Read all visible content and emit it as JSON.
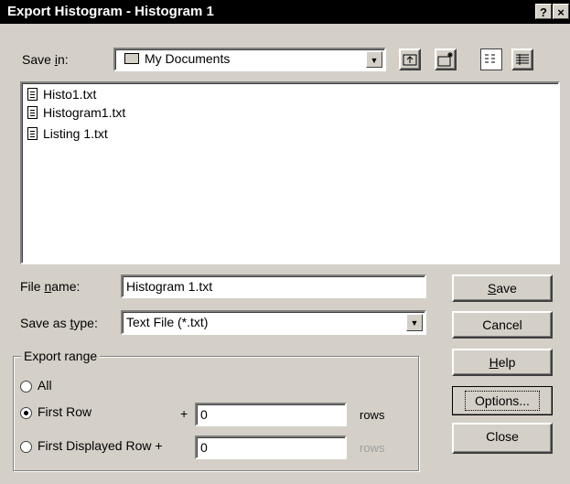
{
  "window": {
    "title": "Export Histogram - Histogram 1",
    "help_glyph": "?",
    "close_glyph": "×"
  },
  "save_in": {
    "label_pre": "Save ",
    "label_key": "i",
    "label_post": "n:",
    "value": "My Documents",
    "folder_icon": "folder-icon"
  },
  "toolbar": {
    "up_icon": "up-folder-icon",
    "new_folder_icon": "new-folder-icon",
    "list_icon": "list-view-icon",
    "details_icon": "details-view-icon"
  },
  "files": [
    {
      "name": "Histo1.txt"
    },
    {
      "name": "Histogram1.txt"
    },
    {
      "name": "Listing 1.txt"
    }
  ],
  "file_name": {
    "label_pre": "File ",
    "label_key": "n",
    "label_post": "ame:",
    "value": "Histogram 1.txt"
  },
  "save_as_type": {
    "label_pre": "Save as ",
    "label_key": "t",
    "label_post": "ype:",
    "value": "Text File (*.txt)"
  },
  "export_range": {
    "label": "Export range",
    "options": [
      {
        "label": "All",
        "selected": false
      },
      {
        "label": "First Row",
        "selected": true,
        "plus": "+",
        "value": "0",
        "unit": "rows"
      },
      {
        "label": "First Displayed Row +",
        "selected": false,
        "value": "0",
        "unit": "rows"
      }
    ]
  },
  "buttons": {
    "save_key": "S",
    "save_rest": "ave",
    "cancel": "Cancel",
    "help_key": "H",
    "help_rest": "elp",
    "options": "Options...",
    "close": "Close"
  }
}
